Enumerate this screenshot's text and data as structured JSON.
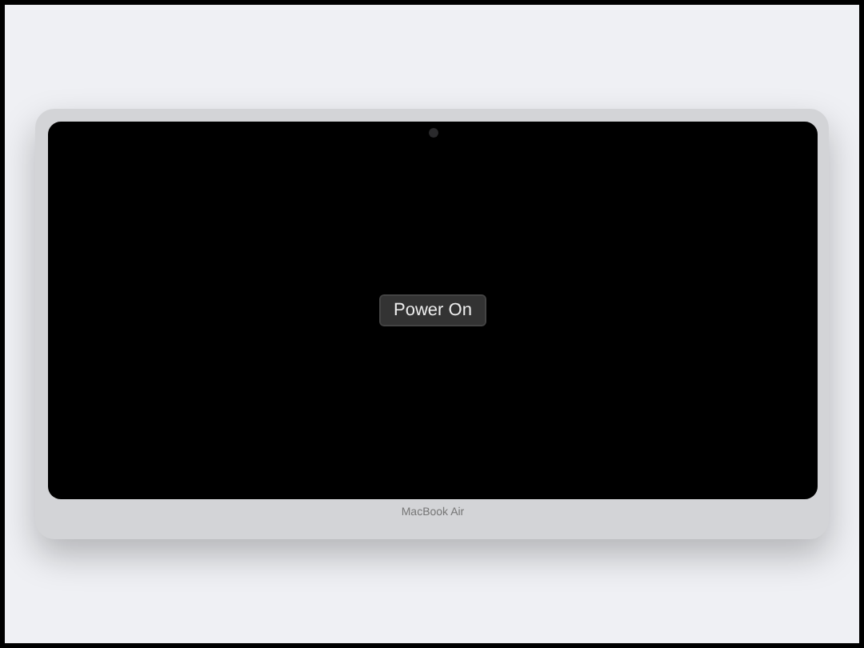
{
  "screen": {
    "power_button": "Power On"
  },
  "laptop": {
    "model_label": "MacBook Air"
  }
}
